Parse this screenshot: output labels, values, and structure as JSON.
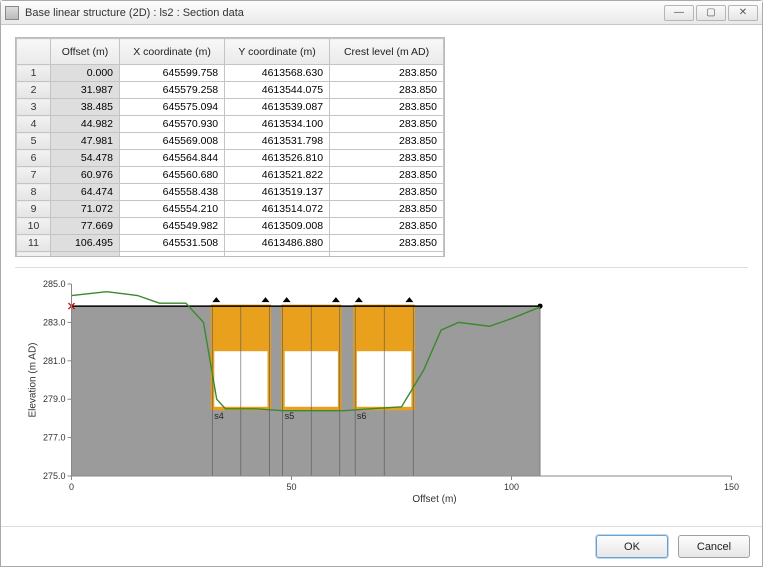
{
  "window": {
    "title": "Base linear structure (2D) : ls2 : Section data"
  },
  "table": {
    "headers": [
      "Offset (m)",
      "X coordinate (m)",
      "Y coordinate (m)",
      "Crest level (m AD)"
    ],
    "rows": [
      {
        "n": "1",
        "offset": "0.000",
        "x": "645599.758",
        "y": "4613568.630",
        "crest": "283.850"
      },
      {
        "n": "2",
        "offset": "31.987",
        "x": "645579.258",
        "y": "4613544.075",
        "crest": "283.850"
      },
      {
        "n": "3",
        "offset": "38.485",
        "x": "645575.094",
        "y": "4613539.087",
        "crest": "283.850"
      },
      {
        "n": "4",
        "offset": "44.982",
        "x": "645570.930",
        "y": "4613534.100",
        "crest": "283.850"
      },
      {
        "n": "5",
        "offset": "47.981",
        "x": "645569.008",
        "y": "4613531.798",
        "crest": "283.850"
      },
      {
        "n": "6",
        "offset": "54.478",
        "x": "645564.844",
        "y": "4613526.810",
        "crest": "283.850"
      },
      {
        "n": "7",
        "offset": "60.976",
        "x": "645560.680",
        "y": "4613521.822",
        "crest": "283.850"
      },
      {
        "n": "8",
        "offset": "64.474",
        "x": "645558.438",
        "y": "4613519.137",
        "crest": "283.850"
      },
      {
        "n": "9",
        "offset": "71.072",
        "x": "645554.210",
        "y": "4613514.072",
        "crest": "283.850"
      },
      {
        "n": "10",
        "offset": "77.669",
        "x": "645549.982",
        "y": "4613509.008",
        "crest": "283.850"
      },
      {
        "n": "11",
        "offset": "106.495",
        "x": "645531.508",
        "y": "4613486.880",
        "crest": "283.850"
      }
    ],
    "newrow": "*"
  },
  "chart_data": {
    "type": "area",
    "xlabel": "Offset (m)",
    "ylabel": "Elevation (m AD)",
    "xlim": [
      0,
      150
    ],
    "ylim": [
      275,
      285
    ],
    "xticks": [
      0,
      50,
      100,
      150
    ],
    "yticks": [
      275.0,
      277.0,
      279.0,
      281.0,
      283.0,
      285.0
    ],
    "crest_level": 283.85,
    "crest_extent": [
      0,
      106.495
    ],
    "section_breaks": [
      0,
      31.987,
      38.485,
      44.982,
      47.981,
      54.478,
      60.976,
      64.474,
      71.072,
      77.669,
      106.495
    ],
    "culvert_top": 283.85,
    "culvert_fill_bottom": 281.5,
    "culvert_bottom": 278.5,
    "culverts": [
      {
        "name": "s4",
        "x0": 32.0,
        "x1": 45.0
      },
      {
        "name": "s5",
        "x0": 48.0,
        "x1": 61.0
      },
      {
        "name": "s6",
        "x0": 64.4,
        "x1": 77.7
      }
    ],
    "ground_profile": [
      {
        "x": 0,
        "y": 284.4
      },
      {
        "x": 8,
        "y": 284.6
      },
      {
        "x": 15,
        "y": 284.4
      },
      {
        "x": 20,
        "y": 284.0
      },
      {
        "x": 26,
        "y": 284.0
      },
      {
        "x": 30,
        "y": 283.0
      },
      {
        "x": 33,
        "y": 279.0
      },
      {
        "x": 35,
        "y": 278.5
      },
      {
        "x": 42,
        "y": 278.5
      },
      {
        "x": 48,
        "y": 278.4
      },
      {
        "x": 55,
        "y": 278.4
      },
      {
        "x": 62,
        "y": 278.4
      },
      {
        "x": 68,
        "y": 278.5
      },
      {
        "x": 75,
        "y": 278.6
      },
      {
        "x": 80,
        "y": 280.5
      },
      {
        "x": 84,
        "y": 282.6
      },
      {
        "x": 88,
        "y": 283.0
      },
      {
        "x": 95,
        "y": 282.8
      },
      {
        "x": 100,
        "y": 283.2
      },
      {
        "x": 106.5,
        "y": 283.8
      }
    ]
  },
  "buttons": {
    "ok": "OK",
    "cancel": "Cancel"
  }
}
